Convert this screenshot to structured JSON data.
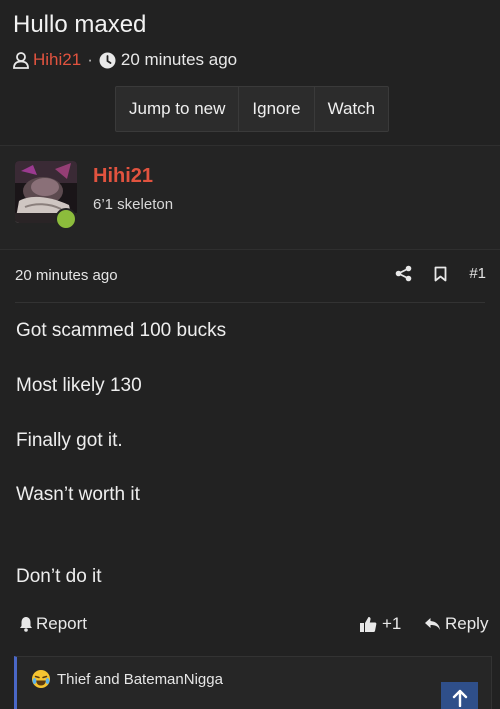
{
  "thread": {
    "title": "Hullo maxed",
    "author": "Hihi21",
    "separator": "·",
    "time": "20 minutes ago"
  },
  "buttons": {
    "jump_to_new": "Jump to new",
    "ignore": "Ignore",
    "watch": "Watch"
  },
  "post": {
    "username": "Hihi21",
    "user_title": "6’1 skeleton",
    "time": "20 minutes ago",
    "number": "#1",
    "body_lines": [
      "Got scammed 100 bucks",
      "Most likely 130",
      "Finally got it.",
      "Wasn’t worth it",
      "Don’t do it"
    ],
    "report_label": "Report",
    "like_count": "+1",
    "reply_label": "Reply",
    "reactions_text": "Thief and BatemanNigga",
    "reaction_emoji": "crying-laughing-emoji"
  },
  "colors": {
    "background": "#222222",
    "username": "#e1533f",
    "online": "#8cbc3c",
    "reaction_bar": "#4a67c6",
    "scroll_button": "#2f4f8a"
  },
  "icons": {
    "user": "user-icon",
    "clock": "clock-icon",
    "share": "share-icon",
    "bookmark": "bookmark-icon",
    "bell": "bell-icon",
    "thumbs_up": "thumbs-up-icon",
    "reply": "reply-icon",
    "arrow_up": "arrow-up-icon"
  }
}
